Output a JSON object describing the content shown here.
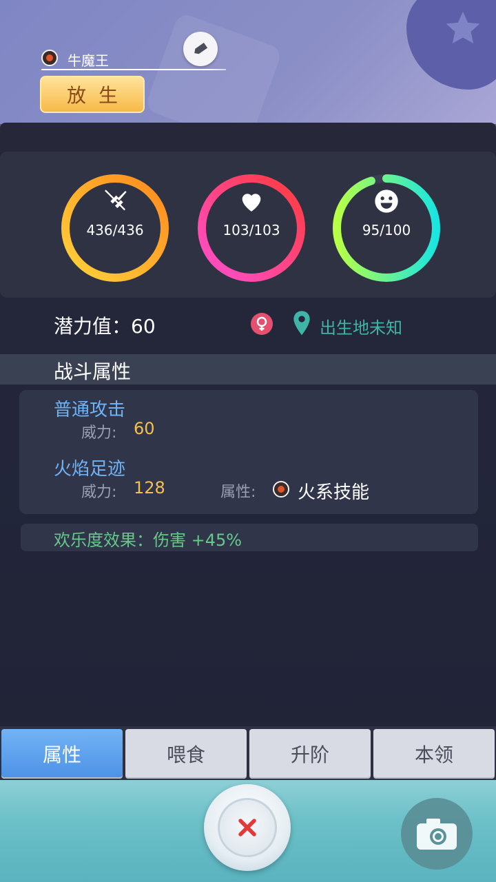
{
  "header": {
    "pet_name": "牛魔王",
    "release_label": "放生"
  },
  "stats": {
    "attack": {
      "value_text": "436/436",
      "fraction": 1.0,
      "icon": "crossed-swords-icon"
    },
    "health": {
      "value_text": "103/103",
      "fraction": 1.0,
      "icon": "heart-icon"
    },
    "happiness": {
      "value_text": "95/100",
      "fraction": 0.95,
      "icon": "smiley-icon"
    }
  },
  "info": {
    "potential": "潜力值：60",
    "gender_icon": "female-icon",
    "location_icon": "map-pin-icon",
    "birthplace": "出生地未知"
  },
  "battle": {
    "section_title": "战斗属性",
    "skills": [
      {
        "name": "普通攻击",
        "power_label": "威力:",
        "power_value": "60"
      },
      {
        "name": "火焰足迹",
        "power_label": "威力:",
        "power_value": "128",
        "attr_label": "属性:",
        "attr_value": "火系技能"
      }
    ],
    "joy_effect": "欢乐度效果：伤害  +45%"
  },
  "tabs": [
    {
      "label": "属性",
      "active": true
    },
    {
      "label": "喂食",
      "active": false
    },
    {
      "label": "升阶",
      "active": false
    },
    {
      "label": "本领",
      "active": false
    }
  ],
  "colors": {
    "attack_ring": [
      "#ffd23a",
      "#ff8a1e"
    ],
    "health_ring": [
      "#ff4fd0",
      "#ff3b3b"
    ],
    "happiness_ring": [
      "#b8ff45",
      "#19e6e0"
    ],
    "skill_name": "#6fb4f7",
    "value_gold": "#f5c04e",
    "joy_green": "#66c98a",
    "birthplace_teal": "#3fb5a8"
  }
}
